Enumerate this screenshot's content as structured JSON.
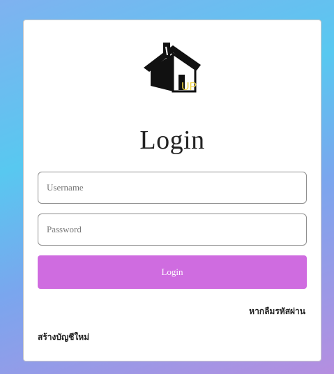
{
  "brand": {
    "logo_icon": "house-icon",
    "logo_text": "UP",
    "logo_text_color": "#f2d541"
  },
  "login": {
    "title": "Login",
    "username_placeholder": "Username",
    "password_placeholder": "Password",
    "submit_label": "Login",
    "forgot_password_link": "หากลืมรหัสผ่าน",
    "create_account_link": "สร้างบัญชีใหม่"
  },
  "colors": {
    "button": "#cf6ce0",
    "background_gradient": [
      "#58c8f0",
      "#b58ee0"
    ]
  }
}
